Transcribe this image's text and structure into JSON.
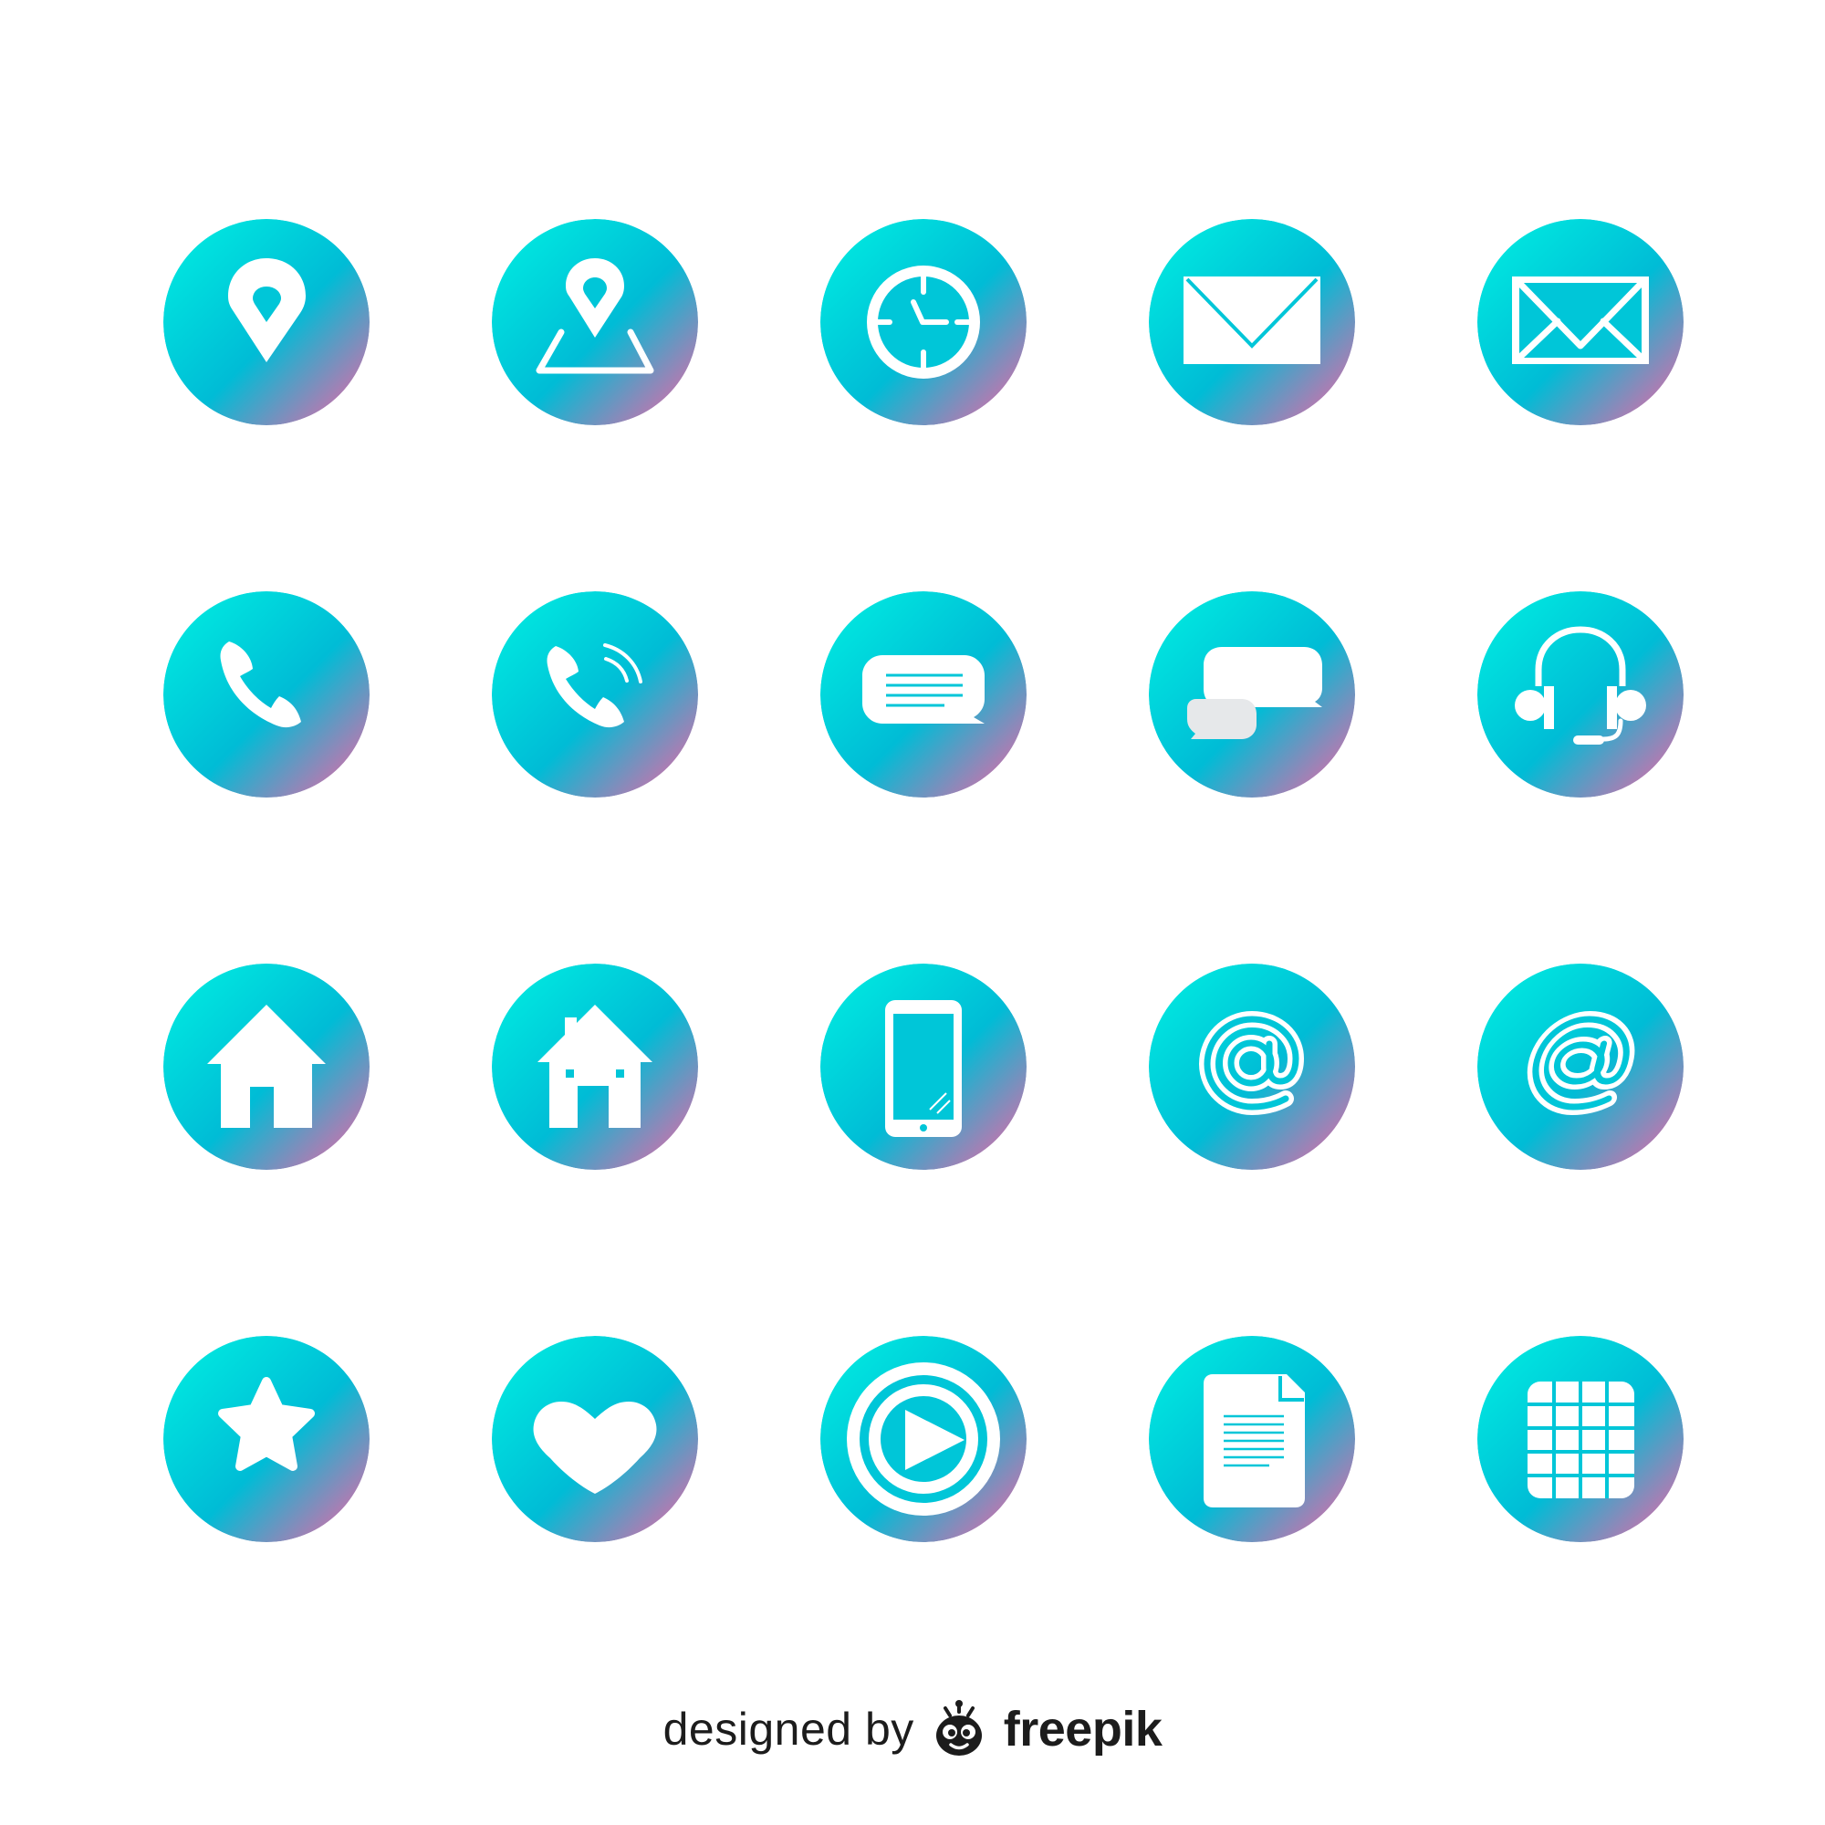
{
  "palette": {
    "gradient_start": "#00f0e2",
    "gradient_mid": "#00bcd6",
    "gradient_end": "#ff5fa2",
    "glyph": "#ffffff",
    "glyph_cutout": "#00c6d8",
    "background": "#ffffff",
    "credit_text": "#1c1c1c"
  },
  "icons": [
    [
      "location-pin-icon",
      "map-location-icon",
      "clock-icon",
      "envelope-icon",
      "envelope-outline-icon"
    ],
    [
      "phone-icon",
      "phone-ringing-icon",
      "message-bubble-icon",
      "chat-bubbles-icon",
      "headset-icon"
    ],
    [
      "home-icon",
      "home-chimney-icon",
      "smartphone-icon",
      "at-sign-icon",
      "at-sign-italic-icon"
    ],
    [
      "star-icon",
      "heart-icon",
      "play-button-icon",
      "document-icon",
      "grid-table-icon"
    ]
  ],
  "credit": {
    "prefix": "designed by",
    "brand": "freepik",
    "logo_icon": "freepik-mascot-icon"
  }
}
